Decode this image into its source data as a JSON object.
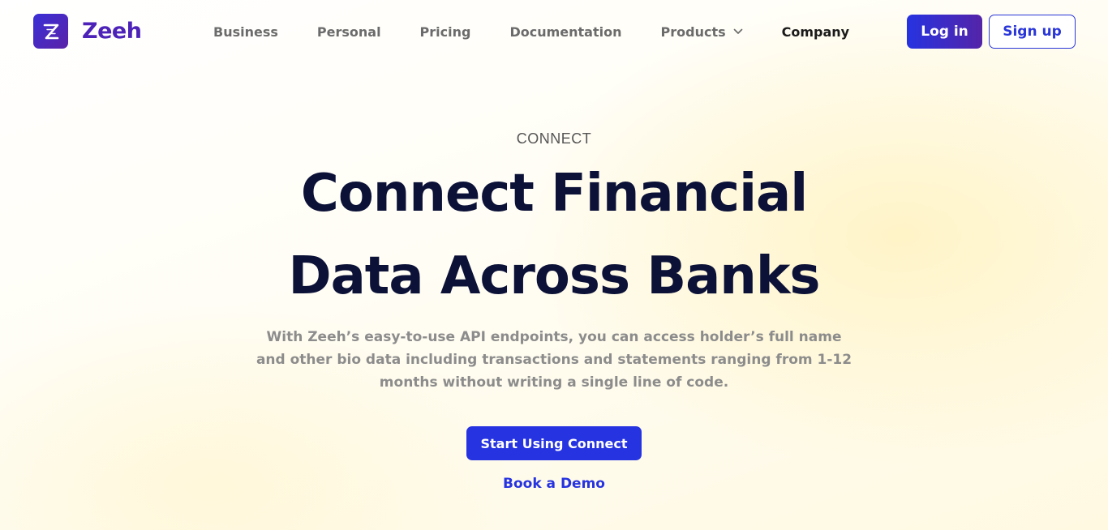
{
  "brand": {
    "name": "Zeeh",
    "logo_icon": "zeeh-z-logo-icon"
  },
  "nav": {
    "items": [
      {
        "label": "Business"
      },
      {
        "label": "Personal"
      },
      {
        "label": "Pricing"
      },
      {
        "label": "Documentation"
      },
      {
        "label": "Products",
        "icon": "chevron-down-icon"
      },
      {
        "label": "Company"
      }
    ]
  },
  "auth": {
    "login_label": "Log in",
    "signup_label": "Sign up"
  },
  "hero": {
    "eyebrow": "CONNECT",
    "title_line1": "Connect Financial",
    "title_line2": "Data Across Banks",
    "description": "With Zeeh’s easy-to-use API endpoints, you can access holder’s full name and other bio data including transactions and statements ranging from 1-12 months without writing a single line of code.",
    "cta_label": "Start Using Connect",
    "secondary_link_label": "Book a Demo"
  },
  "colors": {
    "brand_primary": "#2633e0",
    "brand_purple": "#4c22b8",
    "heading": "#0b1137",
    "muted_text": "#8c8c8c",
    "background_tint": "#fff6d6"
  }
}
